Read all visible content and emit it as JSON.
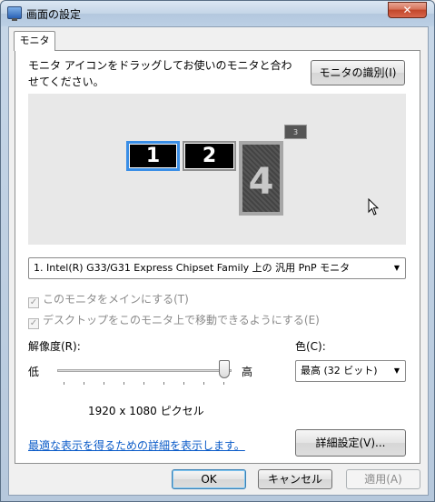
{
  "window": {
    "title": "画面の設定",
    "close_label": "✕"
  },
  "tab": {
    "label": "モニタ"
  },
  "instructions": "モニタ アイコンをドラッグしてお使いのモニタと合わせてください。",
  "identify_button": "モニタの識別(I)",
  "monitors": [
    {
      "label": "1",
      "selected": true
    },
    {
      "label": "2",
      "selected": false
    },
    {
      "label": "4",
      "selected": false
    },
    {
      "label": "3",
      "selected": false
    }
  ],
  "display_select": {
    "value": "1. Intel(R) G33/G31 Express Chipset Family 上の 汎用 PnP モニタ",
    "arrow": "▼"
  },
  "checkboxes": [
    {
      "label": "このモニタをメインにする(T)",
      "checked": true,
      "enabled": false
    },
    {
      "label": "デスクトップをこのモニタ上で移動できるようにする(E)",
      "checked": true,
      "enabled": false
    }
  ],
  "resolution": {
    "label": "解像度(R):",
    "low": "低",
    "high": "高",
    "value_text": "1920 x 1080 ピクセル",
    "slider_level": 1.0
  },
  "color": {
    "label": "色(C):",
    "value": "最高 (32 ビット)",
    "arrow": "▼"
  },
  "help_link": "最適な表示を得るための詳細を表示します。",
  "advanced_button": "詳細設定(V)...",
  "footer": {
    "ok": "OK",
    "cancel": "キャンセル",
    "apply": "適用(A)"
  }
}
